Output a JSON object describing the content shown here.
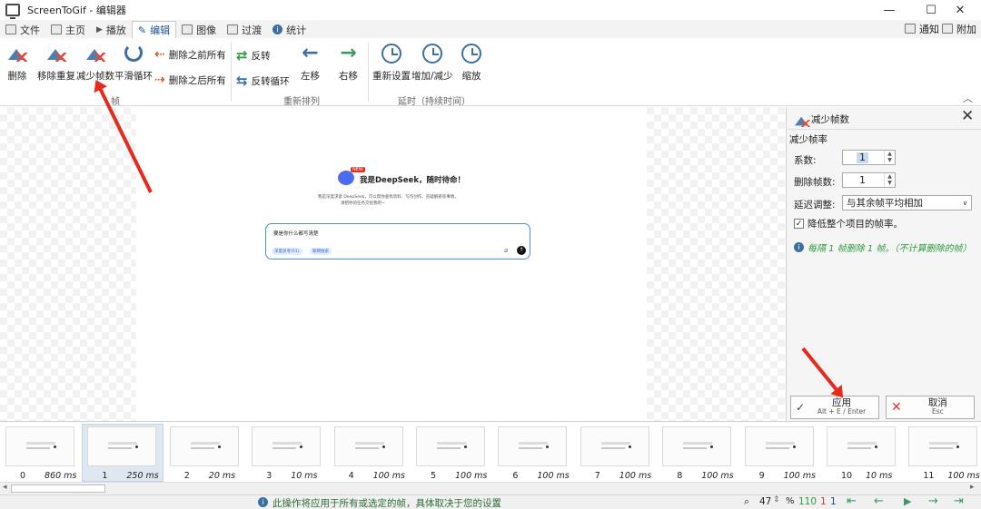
{
  "window": {
    "title": "ScreenToGif - 编辑器",
    "minimize": "—",
    "maximize": "☐",
    "close": "✕"
  },
  "tabs": [
    {
      "label": "文件"
    },
    {
      "label": "主页"
    },
    {
      "label": "播放"
    },
    {
      "label": "编辑"
    },
    {
      "label": "图像"
    },
    {
      "label": "过渡"
    },
    {
      "label": "统计"
    }
  ],
  "tabs_right": {
    "notify": "通知",
    "attach": "附加"
  },
  "ribbon": {
    "frames": {
      "delete": "删除",
      "remove_dup": "移除重复",
      "reduce": "减少帧数",
      "smooth_loop": "平滑循环",
      "delete_before": "删除之前所有",
      "delete_after": "删除之后所有",
      "group_label": "帧"
    },
    "reorder": {
      "reverse": "反转",
      "yoyo": "反转循环",
      "move_left": "左移",
      "move_right": "右移",
      "group_label": "重新排列"
    },
    "delay": {
      "override": "重新设置",
      "increase": "增加/减少",
      "scale": "缩放",
      "group_label": "延时（持续时间）"
    }
  },
  "preview": {
    "heading": "我是DeepSeek，随时待命！",
    "badge": "NEW",
    "sub1": "我是深度求索 DeepSeek，可以帮你查找资料、写作创作、答疑解惑等事情，",
    "sub2": "请把你的任务交给我吧~",
    "input_text": "要是你什么都写清楚",
    "chip1": "深度思考(R1)",
    "chip2": "联网搜索"
  },
  "panel": {
    "title": "减少帧数",
    "section": "减少帧率",
    "factor_label": "系数:",
    "factor_value": "1",
    "remove_label": "删除帧数:",
    "remove_value": "1",
    "delay_label": "延迟调整:",
    "delay_value": "与其余帧平均相加",
    "checkbox_label": "降低整个项目的帧率。",
    "info": "每隔 1 帧删除 1 帧。（不计算删除的帧）",
    "apply": "应用",
    "apply_shortcut": "Alt + E / Enter",
    "cancel": "取消",
    "cancel_shortcut": "Esc"
  },
  "frames": [
    {
      "n": "0",
      "d": "860 ms"
    },
    {
      "n": "1",
      "d": "250 ms"
    },
    {
      "n": "2",
      "d": "20 ms"
    },
    {
      "n": "3",
      "d": "10 ms"
    },
    {
      "n": "4",
      "d": "100 ms"
    },
    {
      "n": "5",
      "d": "100 ms"
    },
    {
      "n": "6",
      "d": "100 ms"
    },
    {
      "n": "7",
      "d": "100 ms"
    },
    {
      "n": "8",
      "d": "100 ms"
    },
    {
      "n": "9",
      "d": "100 ms"
    },
    {
      "n": "10",
      "d": "10 ms"
    },
    {
      "n": "11",
      "d": "100 ms"
    }
  ],
  "status": {
    "message": "此操作将应用于所有或选定的帧，具体取决于您的设置",
    "zoom": "47",
    "percent": "%",
    "total": "110",
    "selected": "1",
    "current": "1"
  },
  "colors": {
    "accent": "#1b4f91",
    "red": "#e62a1d",
    "green": "#2f9a3e"
  }
}
